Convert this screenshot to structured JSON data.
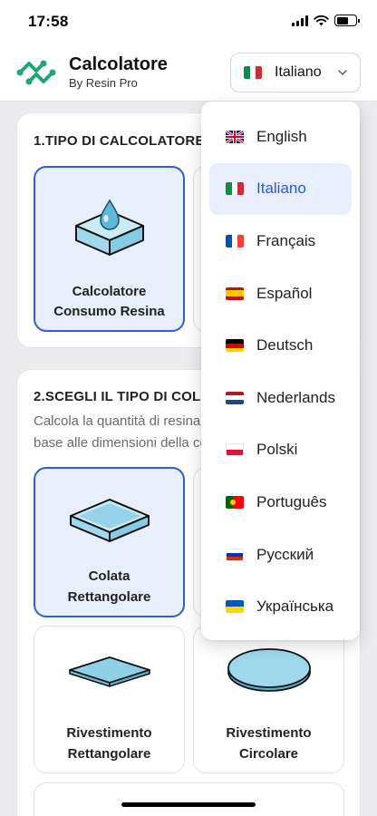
{
  "status": {
    "time": "17:58"
  },
  "header": {
    "title": "Calcolatore",
    "subtitle": "By Resin Pro",
    "language_selected": "Italiano",
    "logo_icon": "resin-logo-icon",
    "accent": "#1ea672"
  },
  "section1": {
    "title": "1.TIPO DI CALCOLATORE",
    "tiles": [
      {
        "label_line1": "Calcolatore",
        "label_line2": "Consumo Resina",
        "icon": "resin-drop-icon",
        "selected": true
      },
      {
        "label_line1": "",
        "label_line2": "",
        "icon": "",
        "selected": false
      }
    ]
  },
  "section2": {
    "title": "2.SCEGLI IL TIPO DI COLATA",
    "description": "Calcola la quantità di resina in base alle dimensioni della colata",
    "tiles": [
      {
        "label_line1": "Colata",
        "label_line2": "Rettangolare",
        "icon": "rectangular-pour-icon",
        "selected": true
      },
      {
        "label_line1": "",
        "label_line2": "",
        "icon": "",
        "selected": false
      },
      {
        "label_line1": "Rivestimento",
        "label_line2": "Rettangolare",
        "icon": "rectangular-coating-icon",
        "selected": false
      },
      {
        "label_line1": "Rivestimento",
        "label_line2": "Circolare",
        "icon": "circular-coating-icon",
        "selected": false
      }
    ]
  },
  "dropdown": {
    "options": [
      {
        "label": "English",
        "flag": "uk-flag-icon",
        "active": false
      },
      {
        "label": "Italiano",
        "flag": "italy-flag-icon",
        "active": true
      },
      {
        "label": "Français",
        "flag": "france-flag-icon",
        "active": false
      },
      {
        "label": "Español",
        "flag": "spain-flag-icon",
        "active": false
      },
      {
        "label": "Deutsch",
        "flag": "germany-flag-icon",
        "active": false
      },
      {
        "label": "Nederlands",
        "flag": "netherlands-flag-icon",
        "active": false
      },
      {
        "label": "Polski",
        "flag": "poland-flag-icon",
        "active": false
      },
      {
        "label": "Português",
        "flag": "portugal-flag-icon",
        "active": false
      },
      {
        "label": "Русский",
        "flag": "russia-flag-icon",
        "active": false
      },
      {
        "label": "Українська",
        "flag": "ukraine-flag-icon",
        "active": false
      }
    ]
  },
  "colors": {
    "selected_border": "#2f5fcf",
    "selected_bg": "#e9eefb",
    "resin_fill": "#9fd8ec"
  }
}
